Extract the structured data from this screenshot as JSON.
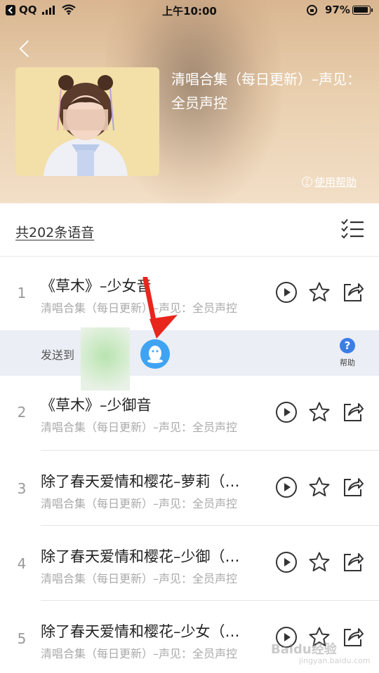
{
  "status_bar": {
    "carrier": "QQ",
    "time": "上午10:00",
    "battery": "97%"
  },
  "header": {
    "album_title": "清唱合集（每日更新）–声见：全员声控",
    "help_link": "使用帮助",
    "help_icon_glyph": "?"
  },
  "list_header": {
    "count_label": "共202条语音"
  },
  "share_bar": {
    "send_to_label": "发送到",
    "help_icon_glyph": "?",
    "help_label": "帮助",
    "target_icon": "qq-penguin-icon"
  },
  "tracks": [
    {
      "num": "1",
      "title": "《草木》–少女音",
      "subtitle": "清唱合集（每日更新）–声见：全员声控"
    },
    {
      "num": "2",
      "title": "《草木》–少御音",
      "subtitle": "清唱合集（每日更新）–声见：全员声控"
    },
    {
      "num": "3",
      "title": "除了春天爱情和樱花–萝莉（…",
      "subtitle": "清唱合集（每日更新）–声见：全员声控"
    },
    {
      "num": "4",
      "title": "除了春天爱情和樱花–少御（…",
      "subtitle": "清唱合集（每日更新）–声见：全员声控"
    },
    {
      "num": "5",
      "title": "除了春天爱情和樱花–少女（…",
      "subtitle": "清唱合集（每日更新）–声见：全员声控"
    }
  ],
  "row_actions": [
    "play-icon",
    "star-icon",
    "share-icon"
  ],
  "colors": {
    "accent_blue": "#3a7ee6",
    "qq_blue": "#3fa3f2",
    "arrow_red": "#e8261c",
    "share_bar_bg": "#ebeef5"
  },
  "watermark": {
    "text": "Baidu经验",
    "sub": "jingyan.baidu.com"
  }
}
